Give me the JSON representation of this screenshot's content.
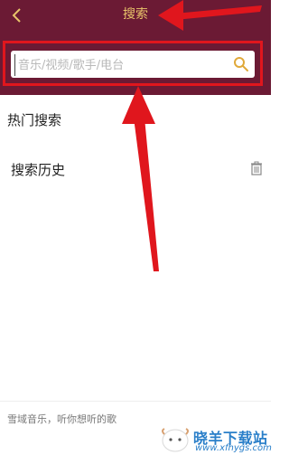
{
  "header": {
    "title": "搜索",
    "back_icon": "chevron-left-icon"
  },
  "search": {
    "placeholder": "音乐/视频/歌手/电台",
    "value": "",
    "icon": "search-icon"
  },
  "sections": {
    "hot_search": "热门搜索",
    "history": "搜索历史",
    "history_clear_icon": "trash-icon"
  },
  "footer": {
    "slogan": "雪域音乐，听你想听的歌"
  },
  "watermark": {
    "title": "晓羊下载站",
    "url": "www.xfhygs.com"
  },
  "colors": {
    "header_bg": "#6b1a34",
    "accent_gold": "#e9c46a",
    "annotation_red": "#e0161d",
    "watermark_blue": "#2a7fc9"
  }
}
